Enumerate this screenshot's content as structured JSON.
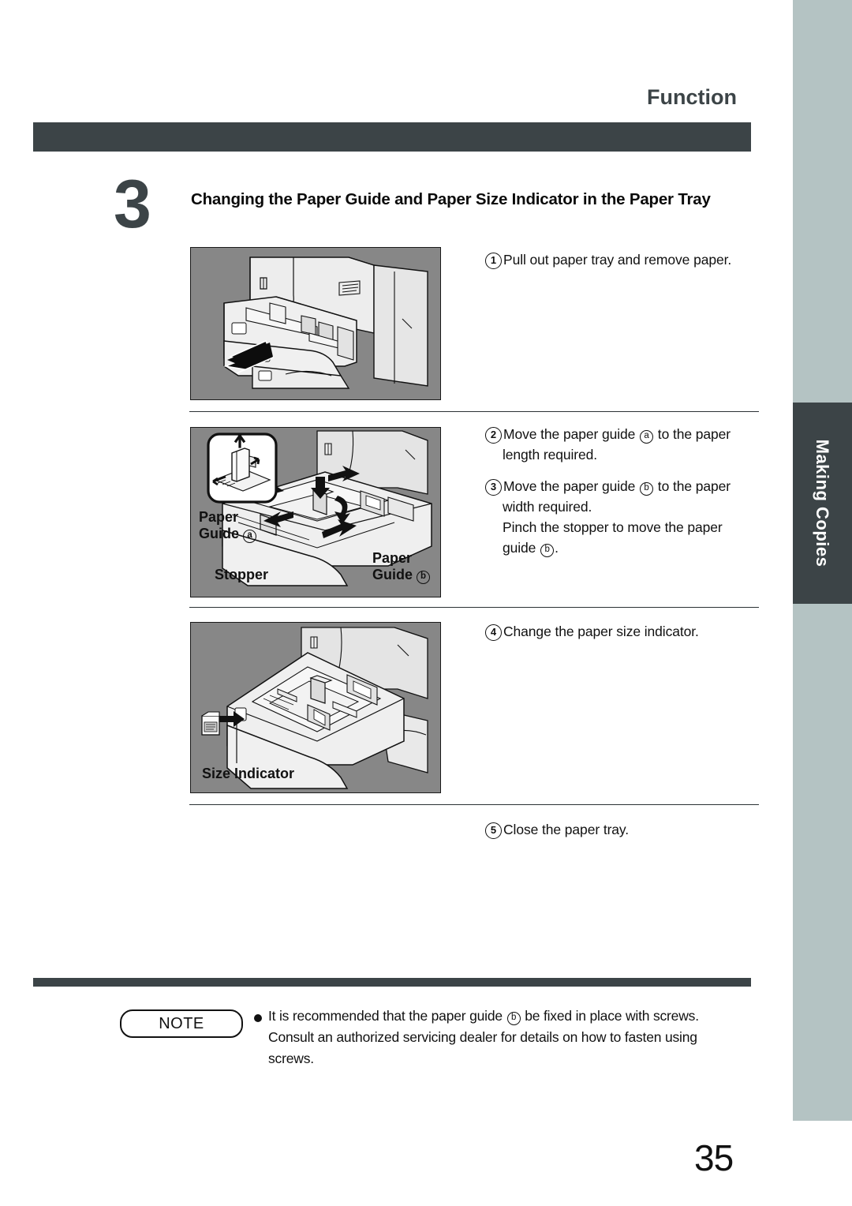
{
  "header": {
    "title": "Function"
  },
  "sidebar": {
    "tab_label": "Making Copies"
  },
  "section": {
    "number": "3",
    "title": "Changing the Paper Guide and Paper Size Indicator in the Paper Tray"
  },
  "steps": [
    {
      "num": "1",
      "lines": [
        "Pull out paper tray and remove paper."
      ]
    },
    {
      "num": "2",
      "lines": [
        "Move the paper guide ⓐ to the paper",
        "length required."
      ]
    },
    {
      "num": "3",
      "lines": [
        "Move the paper guide ⓑ to the paper",
        "width required.",
        "Pinch the stopper to move the paper",
        "guide ⓑ."
      ]
    },
    {
      "num": "4",
      "lines": [
        "Change the paper size indicator."
      ]
    },
    {
      "num": "5",
      "lines": [
        "Close the paper tray."
      ]
    }
  ],
  "step_text": {
    "s1_l1_a": "Pull out paper tray and remove paper.",
    "s2_l1_a": "Move the paper guide ",
    "s2_l1_mark": "a",
    "s2_l1_b": " to the paper",
    "s2_l2": "length required.",
    "s3_l1_a": "Move the paper guide ",
    "s3_l1_mark": "b",
    "s3_l1_b": " to the paper",
    "s3_l2": "width required.",
    "s3_l3": "Pinch the stopper to move the paper",
    "s3_l4_a": "guide ",
    "s3_l4_mark": "b",
    "s3_l4_b": ".",
    "s4_l1": "Change the paper size indicator.",
    "s5_l1": "Close the paper tray."
  },
  "figure_labels": {
    "paper_guide_a_line1": "Paper",
    "paper_guide_a_line2": "Guide",
    "paper_guide_a_mark": "a",
    "stopper": "Stopper",
    "paper_guide_b_line1": "Paper",
    "paper_guide_b_line2": "Guide",
    "paper_guide_b_mark": "b",
    "size_indicator": "Size Indicator"
  },
  "note": {
    "badge": "NOTE",
    "line1_a": "It is recommended that the paper guide ",
    "line1_mark": "b",
    "line1_b": " be fixed in place with screws.",
    "line2": "Consult an authorized servicing dealer for details on how to fasten using",
    "line3": "screws."
  },
  "footer": {
    "page_number": "35"
  },
  "colors": {
    "dark": "#3c4447",
    "side_band": "#b4c3c3",
    "figure_bg": "#878787",
    "text": "#111111"
  }
}
